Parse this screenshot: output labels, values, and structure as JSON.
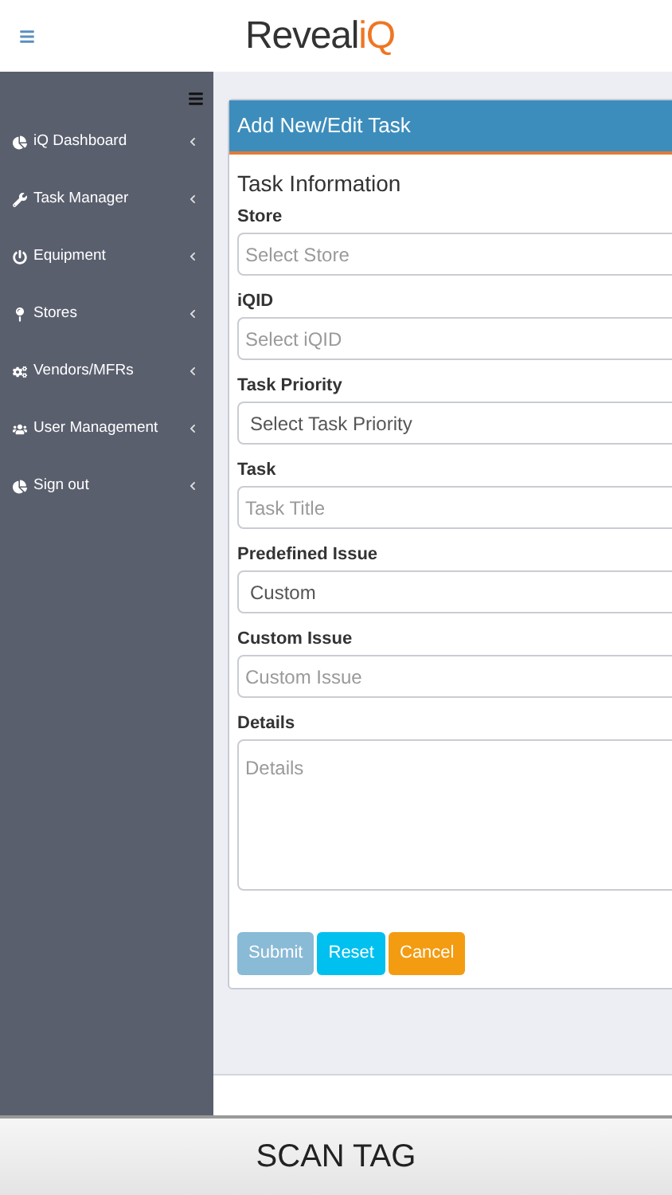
{
  "header": {
    "logo": {
      "dark": "Reveal",
      "accent": "iQ"
    }
  },
  "sidebar": {
    "items": [
      {
        "label": "iQ Dashboard",
        "kind": "pie"
      },
      {
        "label": "Task Manager",
        "kind": "wrench"
      },
      {
        "label": "Equipment",
        "kind": "power"
      },
      {
        "label": "Stores",
        "kind": "pin"
      },
      {
        "label": "Vendors/MFRs",
        "kind": "cogs"
      },
      {
        "label": "User Management",
        "kind": "users"
      },
      {
        "label": "Sign out",
        "kind": "pie"
      }
    ]
  },
  "form": {
    "title": "Add New/Edit Task",
    "section": "Task Information",
    "fields": [
      {
        "label": "Store",
        "kind": "input",
        "placeholder": "Select Store"
      },
      {
        "label": "iQID",
        "kind": "input",
        "placeholder": "Select iQID"
      },
      {
        "label": "Task Priority",
        "kind": "select",
        "value": "Select Task Priority"
      },
      {
        "label": "Task",
        "kind": "input",
        "placeholder": "Task Title"
      },
      {
        "label": "Predefined Issue",
        "kind": "select",
        "value": "Custom"
      },
      {
        "label": "Custom Issue",
        "kind": "input",
        "placeholder": "Custom Issue"
      },
      {
        "label": "Details",
        "kind": "textarea",
        "placeholder": "Details"
      }
    ],
    "buttons": [
      {
        "label": "Submit",
        "kind": "primary",
        "disabled": true
      },
      {
        "label": "Reset",
        "kind": "info",
        "disabled": false
      },
      {
        "label": "Cancel",
        "kind": "warning",
        "disabled": false
      }
    ]
  },
  "scan_button": "SCAN TAG"
}
